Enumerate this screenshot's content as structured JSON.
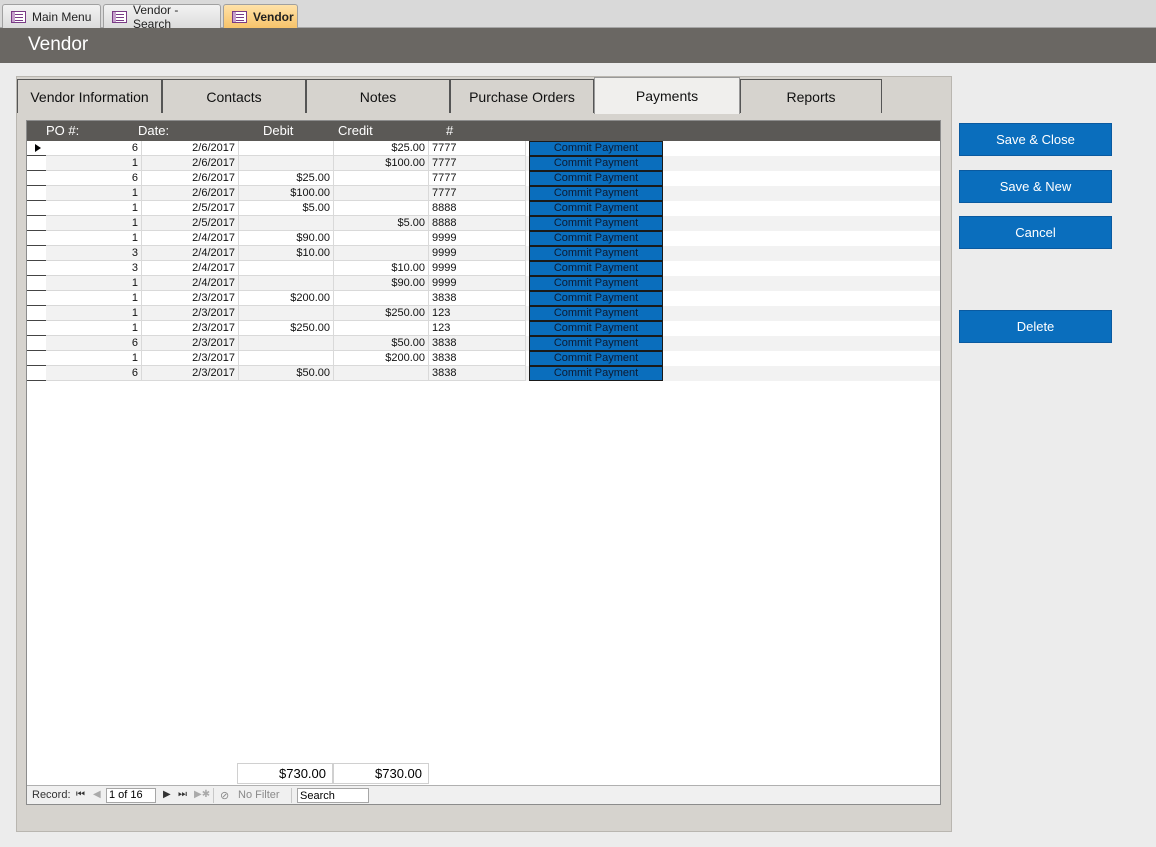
{
  "doc_tabs": [
    {
      "label": "Main Menu",
      "icon": "form-icon"
    },
    {
      "label": "Vendor - Search",
      "icon": "form-icon"
    },
    {
      "label": "Vendor",
      "icon": "form-icon",
      "active": true
    }
  ],
  "title": "Vendor",
  "form_tabs": [
    {
      "label": "Vendor Information"
    },
    {
      "label": "Contacts"
    },
    {
      "label": "Notes"
    },
    {
      "label": "Purchase Orders"
    },
    {
      "label": "Payments",
      "active": true
    },
    {
      "label": "Reports"
    }
  ],
  "grid": {
    "columns": [
      "PO #:",
      "Date:",
      "Debit",
      "Credit",
      "#"
    ],
    "button_label": "Commit Payment",
    "rows": [
      {
        "po": "6",
        "date": "2/6/2017",
        "debit": "",
        "credit": "$25.00",
        "num": "7777"
      },
      {
        "po": "1",
        "date": "2/6/2017",
        "debit": "",
        "credit": "$100.00",
        "num": "7777"
      },
      {
        "po": "6",
        "date": "2/6/2017",
        "debit": "$25.00",
        "credit": "",
        "num": "7777"
      },
      {
        "po": "1",
        "date": "2/6/2017",
        "debit": "$100.00",
        "credit": "",
        "num": "7777"
      },
      {
        "po": "1",
        "date": "2/5/2017",
        "debit": "$5.00",
        "credit": "",
        "num": "8888"
      },
      {
        "po": "1",
        "date": "2/5/2017",
        "debit": "",
        "credit": "$5.00",
        "num": "8888"
      },
      {
        "po": "1",
        "date": "2/4/2017",
        "debit": "$90.00",
        "credit": "",
        "num": "9999"
      },
      {
        "po": "3",
        "date": "2/4/2017",
        "debit": "$10.00",
        "credit": "",
        "num": "9999"
      },
      {
        "po": "3",
        "date": "2/4/2017",
        "debit": "",
        "credit": "$10.00",
        "num": "9999"
      },
      {
        "po": "1",
        "date": "2/4/2017",
        "debit": "",
        "credit": "$90.00",
        "num": "9999"
      },
      {
        "po": "1",
        "date": "2/3/2017",
        "debit": "$200.00",
        "credit": "",
        "num": "3838"
      },
      {
        "po": "1",
        "date": "2/3/2017",
        "debit": "",
        "credit": "$250.00",
        "num": "123"
      },
      {
        "po": "1",
        "date": "2/3/2017",
        "debit": "$250.00",
        "credit": "",
        "num": "123"
      },
      {
        "po": "6",
        "date": "2/3/2017",
        "debit": "",
        "credit": "$50.00",
        "num": "3838"
      },
      {
        "po": "1",
        "date": "2/3/2017",
        "debit": "",
        "credit": "$200.00",
        "num": "3838"
      },
      {
        "po": "6",
        "date": "2/3/2017",
        "debit": "$50.00",
        "credit": "",
        "num": "3838"
      }
    ],
    "totals": {
      "debit": "$730.00",
      "credit": "$730.00"
    }
  },
  "navigation": {
    "record_label": "Record:",
    "record_value": "1 of 16",
    "filter_label": "No Filter",
    "search_placeholder": "Search"
  },
  "buttons": {
    "save_close": "Save & Close",
    "save_new": "Save & New",
    "cancel": "Cancel",
    "delete": "Delete"
  },
  "colors": {
    "accent_button": "#0a6ebd",
    "title_bar": "#6a6763",
    "active_doc_tab": "#f7c36a"
  }
}
